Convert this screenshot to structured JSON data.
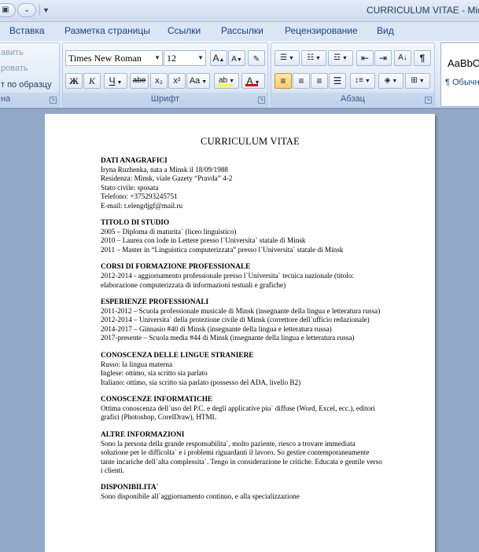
{
  "window": {
    "title": "CURRICULUM VITAE - Mic"
  },
  "tabs": [
    "Вставка",
    "Разметка страницы",
    "Ссылки",
    "Рассылки",
    "Рецензирование",
    "Вид"
  ],
  "clipboard": {
    "item_paste": "авить",
    "item_copy": "ровать",
    "item_format": "т по образцу",
    "label": "на"
  },
  "font": {
    "group_label": "Шрифт",
    "family_value": "Times New Roman",
    "size_value": "12",
    "grow_label": "A",
    "shrink_label": "A",
    "bold_label": "Ж",
    "italic_label": "К",
    "underline_label": "Ч",
    "strike_label": "abe",
    "sub_label": "x₂",
    "sup_label": "x²",
    "case_label": "Aa",
    "highlight_label": "ab",
    "color_label": "A",
    "highlight_color": "#ffff00",
    "font_color": "#e00000"
  },
  "paragraph": {
    "group_label": "Абзац",
    "pilcrow": "¶"
  },
  "styles": {
    "preview": "AaBbC",
    "normal": "¶ Обычн"
  },
  "document": {
    "title": "CURRICULUM VITAE",
    "sections": [
      {
        "heading": "DATI ANAGRAFICI",
        "lines": [
          "Iryna Ruzhenka, nata a Minsk il 18/09/1988",
          "Residenza: Minsk, viale Gazety “Pravda” 4-2",
          "Stato civile: sposata",
          "Telefono: +375293245751",
          "E-mail: t.elengdjgf@mail.ru"
        ]
      },
      {
        "heading": "TITOLO DI STUDIO",
        "lines": [
          "2005 – Diploma di maturita` (liceo linguistico)",
          "2010 – Laurea con lode in Lettere presso l`Universita` statale di Minsk",
          "2011 – Master in “Linguistica computerizzata” presso l`Universita` statale di Minsk"
        ]
      },
      {
        "heading": "CORSI DI FORMAZIONE PROFESSIONALE",
        "lines": [
          "2012-2014 - aggiornamento professionale presso l`Universita` tecnica nazionale (titolo:",
          "elaborazione computerizzata di informazioni testuali e grafiche)"
        ]
      },
      {
        "heading": "ESPERIENZE PROFESSIONALI",
        "lines": [
          "2011-2012 – Scuola professionale musicale di Minsk (insegnante della lingua e letteratura russa)",
          "2012-2014 – Universita` della protezione civile di Minsk (correttore dell`ufficio redazionale)",
          "2014-2017 – Ginnasio #40 di Minsk (insegnante della lingua e letteratura russa)",
          "2017-presente – Scuola media #44 di Minsk (insegnante della lingua e letteratura russa)"
        ]
      },
      {
        "heading": "CONOSCENZA DELLE LINGUE STRANIERE",
        "lines": [
          "Russo: la lingua materna",
          "Inglese: ottimo, sia scritto sia parlato",
          "Italiano: ottimo, sia scritto sia parlato (possesso del ADA, livello B2)"
        ]
      },
      {
        "heading": "CONOSCENZE INFORMATICHE",
        "lines": [
          "Ottima conoscenza dell`uso del P.C. e degli applicative piu` diffuse (Word, Excel, ecc.), editori",
          "grafici (Photoshop, CorelDraw), HTML"
        ]
      },
      {
        "heading": "ALTRE INFORMAZIONI",
        "lines": [
          "Sono la persona della grande responsabilita`, molto paziente, riesco a trovare immediata",
          "soluzione per le difficolta` e i problemi riguardanti il lavoro. So gestire contemporaneamente",
          "tante incariche dell`alta complessita`. Tengo in considerazione le critiche. Educata e gentile verso",
          "i clienti."
        ]
      },
      {
        "heading": "DISPONIBILITA`",
        "lines": [
          "Sono disponibile all`aggiornamento continuo, e alla specializzazione"
        ]
      }
    ]
  }
}
